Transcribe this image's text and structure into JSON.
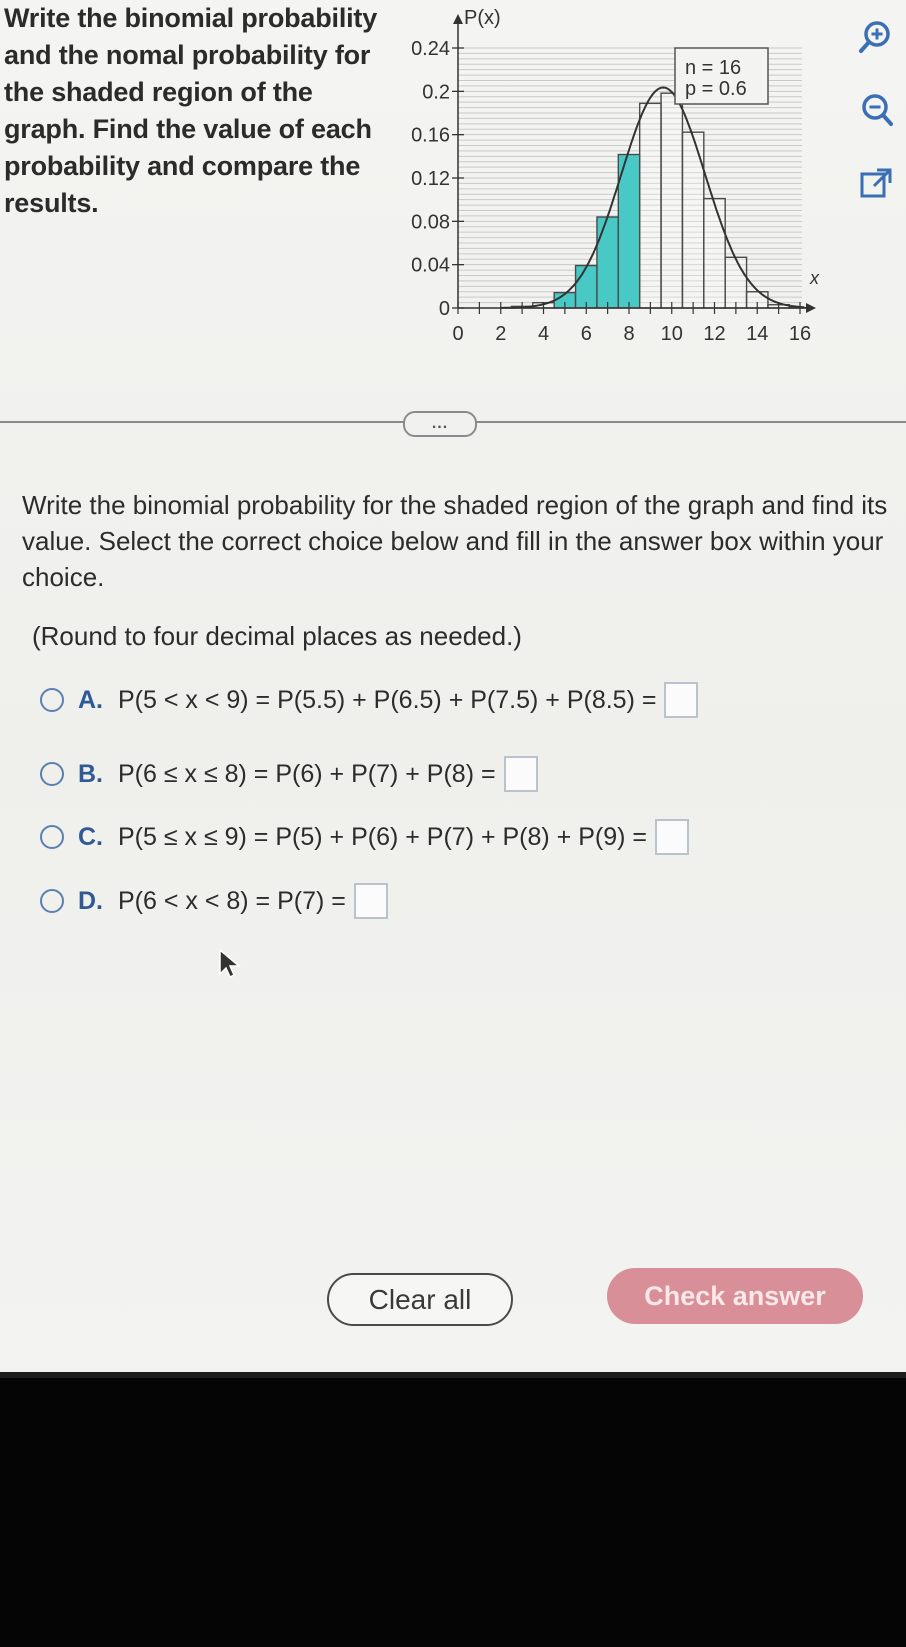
{
  "prompt": {
    "lines": [
      "Write the binomial probability",
      "and the nomal probability for",
      "the shaded region of the",
      "graph. Find the value of each",
      "probability and compare the",
      "results."
    ]
  },
  "chart_data": {
    "type": "bar",
    "y_axis_label": "P(x)",
    "x_axis_label": "x",
    "y_ticks": [
      "0.24",
      "0.2",
      "0.16",
      "0.12",
      "0.08",
      "0.04",
      "0"
    ],
    "x_ticks": [
      "0",
      "2",
      "4",
      "6",
      "8",
      "10",
      "12",
      "14",
      "16"
    ],
    "xlim": [
      0,
      16
    ],
    "ylim": [
      0,
      0.24
    ],
    "legend_lines": [
      "n = 16",
      "p = 0.6"
    ],
    "legend_placement": "top-right",
    "x": [
      0,
      1,
      2,
      3,
      4,
      5,
      6,
      7,
      8,
      9,
      10,
      11,
      12,
      13,
      14,
      15,
      16
    ],
    "values": [
      0.0,
      0.0,
      0.0,
      0.0015,
      0.0049,
      0.0142,
      0.0392,
      0.084,
      0.1417,
      0.1889,
      0.1983,
      0.1623,
      0.101,
      0.0468,
      0.015,
      0.003,
      0.0003
    ],
    "shaded_x": [
      5,
      6,
      7,
      8
    ],
    "shaded_color": "#49c9c6",
    "curve": "normal approximation overlay",
    "grid": "horizontal"
  },
  "tools": [
    "zoom-in-icon",
    "zoom-out-icon",
    "pop-out-icon"
  ],
  "more_label": "...",
  "question": "Write the binomial probability for the shaded region of the graph and find its value. Select the correct choice below and fill in the answer box within your choice.",
  "round_note": "(Round to four decimal places as needed.)",
  "choices": [
    {
      "letter": "A.",
      "expr": "P(5 < x < 9) = P(5.5) + P(6.5) + P(7.5) + P(8.5) ="
    },
    {
      "letter": "B.",
      "expr": "P(6 ≤ x ≤ 8) = P(6) + P(7) + P(8) ="
    },
    {
      "letter": "C.",
      "expr": "P(5 ≤ x ≤ 9) = P(5) + P(6) + P(7) + P(8) + P(9) ="
    },
    {
      "letter": "D.",
      "expr": "P(6 < x < 8) = P(7) ="
    }
  ],
  "buttons": {
    "clear": "Clear all",
    "check": "Check answer"
  },
  "colors": {
    "accent": "#2f5a96",
    "check_button": "#d98f98",
    "shade": "#49c9c6"
  }
}
